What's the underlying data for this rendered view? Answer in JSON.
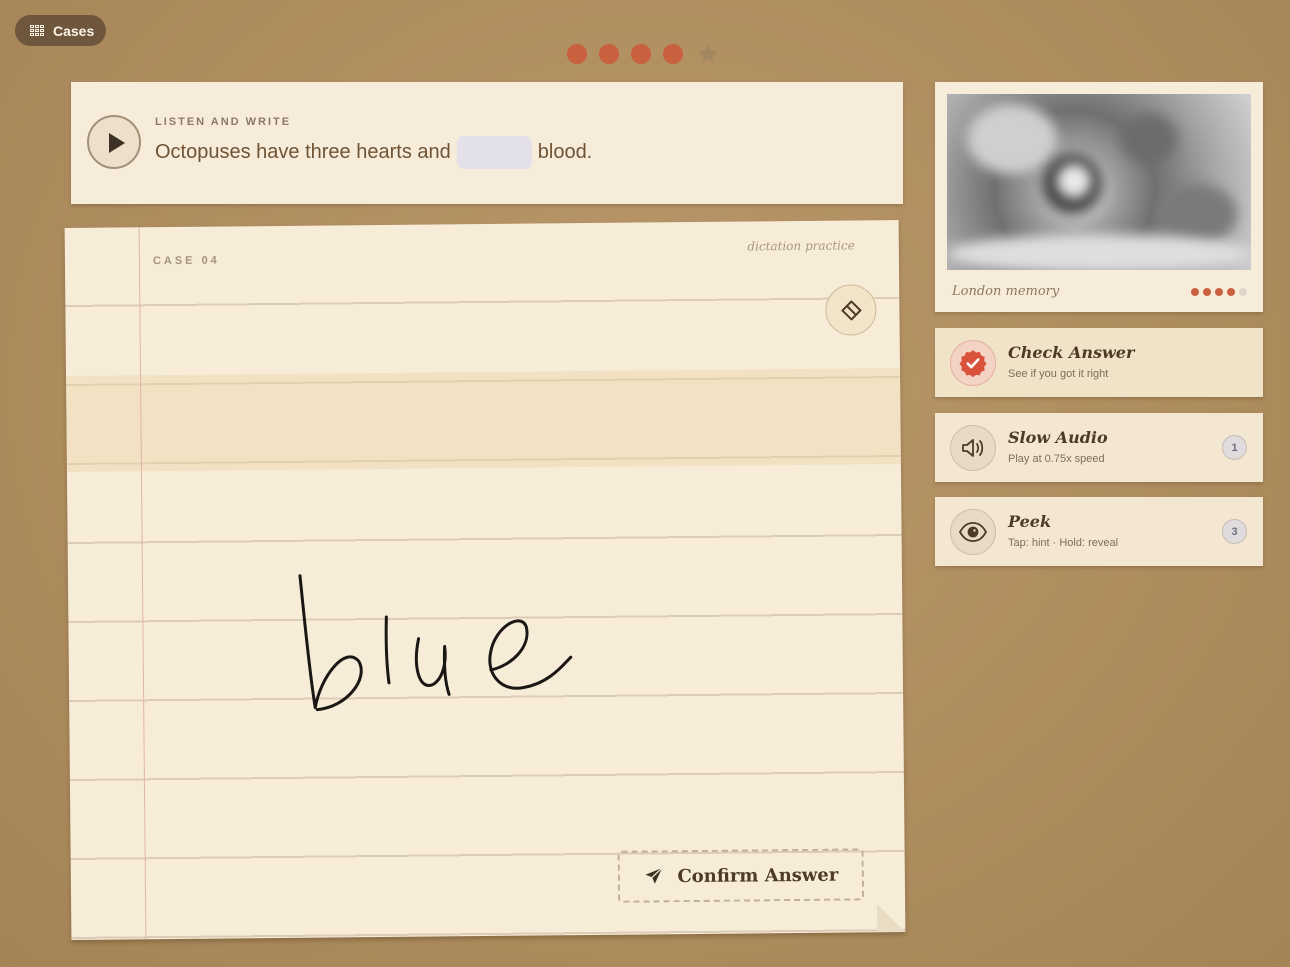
{
  "nav": {
    "cases_label": "Cases",
    "cases_icon": "grid-icon"
  },
  "progress": {
    "completed": 4,
    "total": 5,
    "final_icon": "star-icon",
    "accent_color": "#c9603e"
  },
  "prompt": {
    "label": "LISTEN AND WRITE",
    "text_before": "Octopuses have three hearts and",
    "text_after": "blood.",
    "play_icon": "play-icon"
  },
  "paper": {
    "case_label": "CASE 04",
    "title": "dictation practice",
    "handwritten_answer": "blue",
    "eraser_icon": "eraser-icon",
    "confirm_label": "Confirm Answer",
    "confirm_icon": "send-icon"
  },
  "memory": {
    "caption": "London memory",
    "progress_filled": 4,
    "progress_total": 5
  },
  "actions": [
    {
      "title": "Check Answer",
      "subtitle": "See if you got it right",
      "icon": "check-badge-icon"
    },
    {
      "title": "Slow Audio",
      "subtitle": "Play at 0.75x speed",
      "icon": "speaker-icon",
      "count": "1"
    },
    {
      "title": "Peek",
      "subtitle": "Tap: hint · Hold: reveal",
      "icon": "eye-icon",
      "count": "3"
    }
  ]
}
